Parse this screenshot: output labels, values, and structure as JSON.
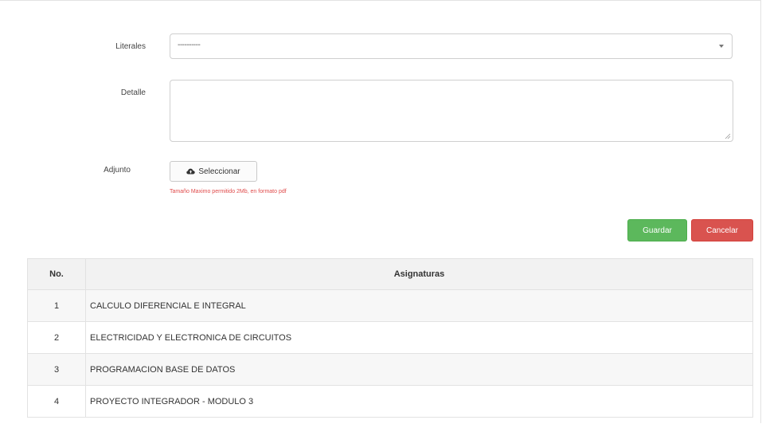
{
  "form": {
    "literales_label": "Literales",
    "literales_value": "----------",
    "detalle_label": "Detalle",
    "detalle_value": "",
    "adjunto_label": "Adjunto",
    "file_button_label": "Seleccionar",
    "help_text": "Tamaño Maximo permitido 2Mb, en formato pdf"
  },
  "actions": {
    "save_label": "Guardar",
    "cancel_label": "Cancelar"
  },
  "table": {
    "headers": [
      "No.",
      "Asignaturas"
    ],
    "rows": [
      {
        "no": "1",
        "asignatura": "CALCULO DIFERENCIAL E INTEGRAL"
      },
      {
        "no": "2",
        "asignatura": "ELECTRICIDAD Y ELECTRONICA DE CIRCUITOS"
      },
      {
        "no": "3",
        "asignatura": "PROGRAMACION BASE DE DATOS"
      },
      {
        "no": "4",
        "asignatura": "PROYECTO INTEGRADOR - MODULO 3"
      }
    ]
  },
  "colors": {
    "save": "#5cb85c",
    "cancel": "#d9534f",
    "help_text": "#e04b4b"
  },
  "icons": {
    "file_button": "cloud-upload-icon",
    "select": "caret-down-icon"
  }
}
